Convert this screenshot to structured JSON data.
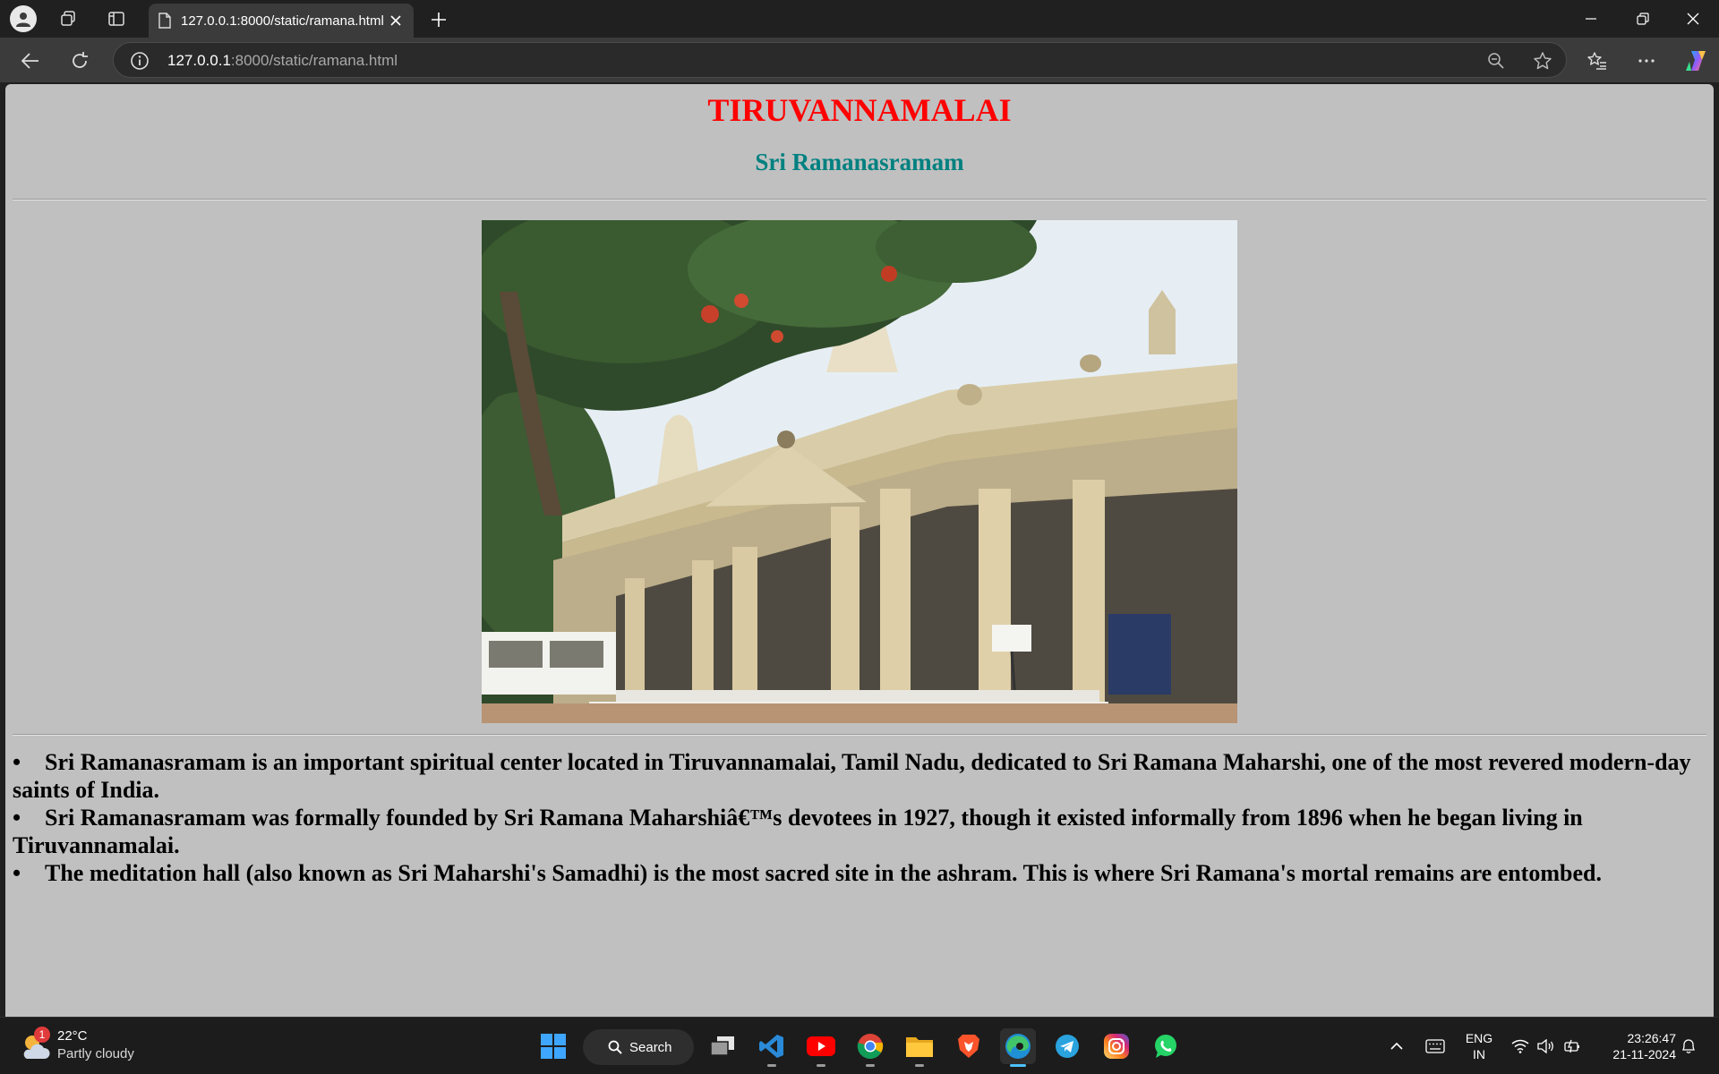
{
  "browser": {
    "tab_title": "127.0.0.1:8000/static/ramana.html",
    "url_host": "127.0.0.1",
    "url_rest": ":8000/static/ramana.html"
  },
  "page": {
    "title": "TIRUVANNAMALAI",
    "subtitle": "Sri Ramanasramam",
    "bullets": [
      "Sri Ramanasramam is an important spiritual center located in Tiruvannamalai, Tamil Nadu, dedicated to Sri Ramana Maharshi, one of the most revered modern-day saints of India.",
      "Sri Ramanasramam was formally founded by Sri Ramana Maharshiâ€™s devotees in 1927, though it existed informally from 1896 when he began living in Tiruvannamalai.",
      "The meditation hall (also known as Sri Maharshi's Samadhi) is the most sacred site in the ashram. This is where Sri Ramana's mortal remains are entombed."
    ],
    "bullet_symbol": "•",
    "colors": {
      "title": "#ff0000",
      "subtitle": "#008080",
      "background": "#c0c0c0"
    }
  },
  "taskbar": {
    "weather_temp": "22°C",
    "weather_desc": "Partly cloudy",
    "weather_badge": "1",
    "search_label": "Search",
    "lang_line1": "ENG",
    "lang_line2": "IN",
    "time": "23:26:47",
    "date": "21-11-2024",
    "apps": [
      "start-icon",
      "search",
      "task-view-icon",
      "vscode-icon",
      "youtube-icon",
      "chrome-icon",
      "file-explorer-icon",
      "brave-icon",
      "edge-icon",
      "telegram-icon",
      "instagram-icon",
      "whatsapp-icon"
    ]
  }
}
